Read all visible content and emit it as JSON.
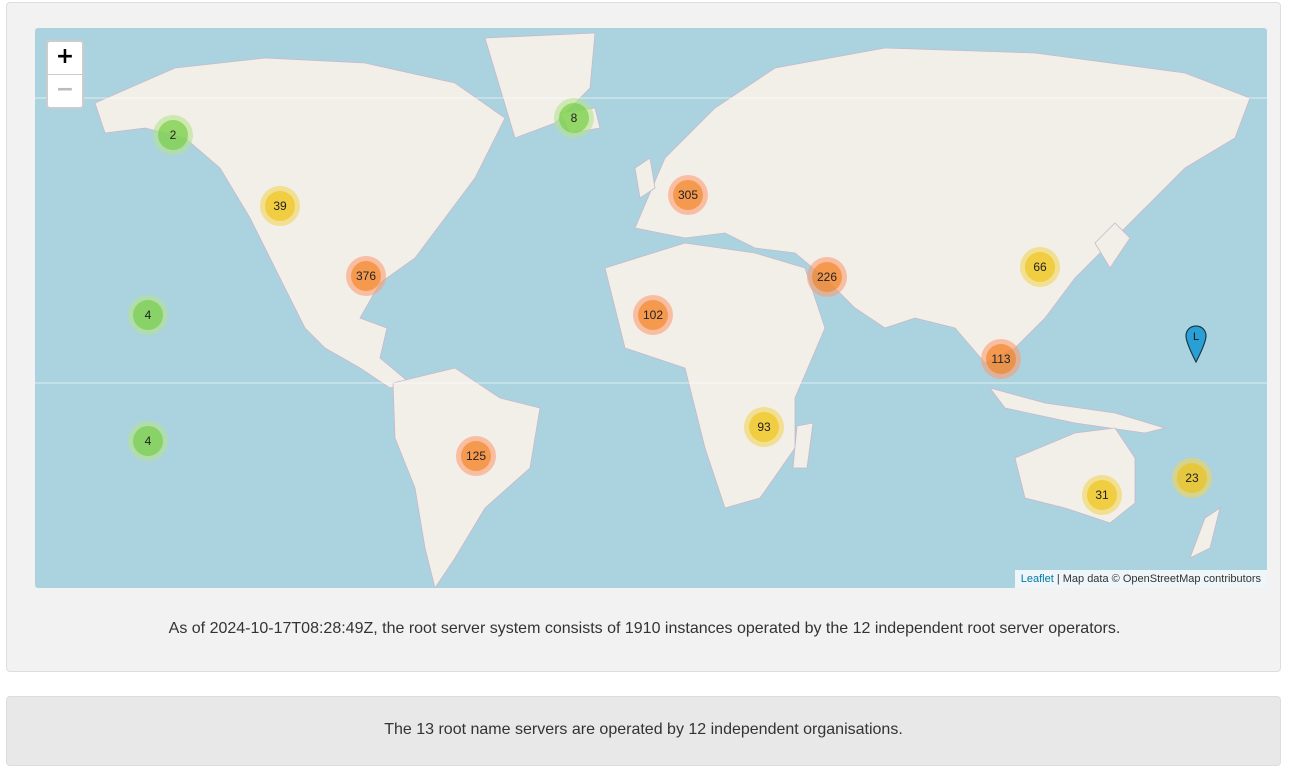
{
  "map": {
    "zoom_in": "+",
    "zoom_out": "−",
    "attribution_link": "Leaflet",
    "attribution_text": " | Map data © OpenStreetMap contributors",
    "pin_label": "L",
    "colors": {
      "water": "#aad3df",
      "land": "#f2efe9",
      "small": "#6ecc39",
      "medium": "#f0c20c",
      "large": "#f18017",
      "pin": "#2a9fd6"
    }
  },
  "clusters": [
    {
      "id": "alaska",
      "count": "2",
      "size": "small"
    },
    {
      "id": "iceland",
      "count": "8",
      "size": "small"
    },
    {
      "id": "western-canada",
      "count": "39",
      "size": "medium"
    },
    {
      "id": "europe",
      "count": "305",
      "size": "large"
    },
    {
      "id": "usa",
      "count": "376",
      "size": "large"
    },
    {
      "id": "middle-east",
      "count": "226",
      "size": "large"
    },
    {
      "id": "east-asia",
      "count": "66",
      "size": "medium"
    },
    {
      "id": "pacific-north",
      "count": "4",
      "size": "small"
    },
    {
      "id": "west-africa",
      "count": "102",
      "size": "large"
    },
    {
      "id": "southeast-asia",
      "count": "113",
      "size": "large"
    },
    {
      "id": "pacific-south",
      "count": "4",
      "size": "small"
    },
    {
      "id": "east-africa",
      "count": "93",
      "size": "medium"
    },
    {
      "id": "south-america",
      "count": "125",
      "size": "large"
    },
    {
      "id": "australia",
      "count": "31",
      "size": "medium"
    },
    {
      "id": "new-zealand",
      "count": "23",
      "size": "medium"
    }
  ],
  "summary": "As of 2024-10-17T08:28:49Z, the root server system consists of 1910 instances operated by the 12 independent root server operators.",
  "operators_note": "The 13 root name servers are operated by 12 independent organisations."
}
